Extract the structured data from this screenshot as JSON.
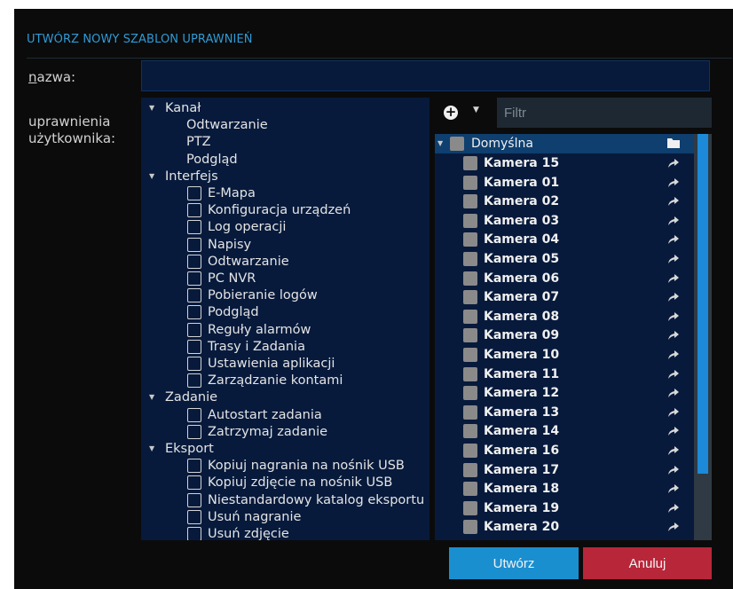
{
  "dialog": {
    "title": "UTWÓRZ NOWY SZABLON UPRAWNIEŃ",
    "name_label_underlined": "n",
    "name_label_rest": "azwa:",
    "name_value": "",
    "permissions_label_1": "uprawnienia",
    "permissions_label_2": "użytkownika:"
  },
  "permissions": {
    "groups": [
      {
        "label": "Kanał",
        "expanded": true,
        "checkboxes": false,
        "items": [
          "Odtwarzanie",
          "PTZ",
          "Podgląd"
        ]
      },
      {
        "label": "Interfejs",
        "expanded": true,
        "checkboxes": true,
        "items": [
          "E-Mapa",
          "Konfiguracja urządzeń",
          "Log operacji",
          "Napisy",
          "Odtwarzanie",
          "PC NVR",
          "Pobieranie logów",
          "Podgląd",
          "Reguły alarmów",
          "Trasy i Zadania",
          "Ustawienia aplikacji",
          "Zarządzanie kontami"
        ]
      },
      {
        "label": "Zadanie",
        "expanded": true,
        "checkboxes": true,
        "items": [
          "Autostart zadania",
          "Zatrzymaj zadanie"
        ]
      },
      {
        "label": "Eksport",
        "expanded": true,
        "checkboxes": true,
        "items": [
          "Kopiuj nagrania na nośnik USB",
          "Kopiuj zdjęcie na nośnik USB",
          "Niestandardowy katalog eksportu",
          "Usuń nagranie",
          "Usuń zdjęcie"
        ]
      }
    ]
  },
  "camera_toolbar": {
    "add_icon": "plus-circle-icon",
    "dropdown_icon": "caret-down-icon",
    "filter_placeholder": "Filtr",
    "filter_value": ""
  },
  "camera_tree": {
    "root_label": "Domyślna",
    "root_icon": "folder-icon",
    "item_icon": "arrow-icon",
    "cameras": [
      "Kamera 15",
      "Kamera 01",
      "Kamera 02",
      "Kamera 03",
      "Kamera 04",
      "Kamera 05",
      "Kamera 06",
      "Kamera 07",
      "Kamera 08",
      "Kamera 09",
      "Kamera 10",
      "Kamera 11",
      "Kamera 12",
      "Kamera 13",
      "Kamera 14",
      "Kamera 16",
      "Kamera 17",
      "Kamera 18",
      "Kamera 19",
      "Kamera 20"
    ]
  },
  "buttons": {
    "create_label": "Utwórz",
    "cancel_label": "Anuluj"
  },
  "colors": {
    "accent": "#2f9bd6",
    "panel_bg": "#071a3c",
    "create": "#1a8fd0",
    "cancel": "#b8263a"
  }
}
